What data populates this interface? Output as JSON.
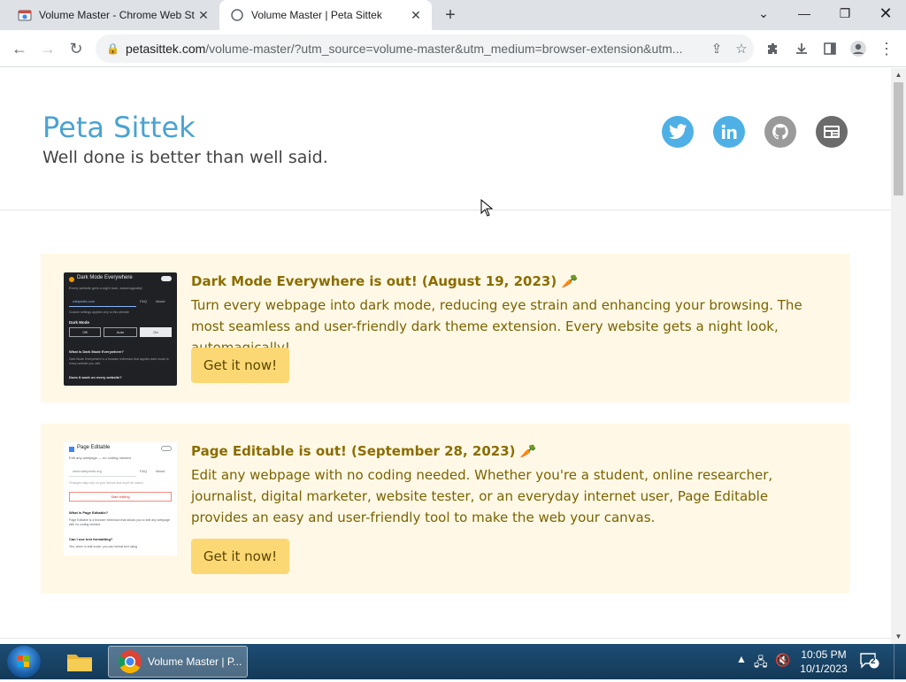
{
  "browser": {
    "tabs": [
      {
        "title": "Volume Master - Chrome Web Store",
        "active": false
      },
      {
        "title": "Volume Master | Peta Sittek",
        "active": true
      }
    ],
    "url_host": "petasittek.com",
    "url_path": "/volume-master/?utm_source=volume-master&utm_medium=browser-extension&utm..."
  },
  "site": {
    "title": "Peta Sittek",
    "tagline": "Well done is better than well said.",
    "social": [
      {
        "icon": "twitter-icon",
        "color": "#4fb0e6"
      },
      {
        "icon": "linkedin-icon",
        "color": "#4fb0e6"
      },
      {
        "icon": "github-icon",
        "color": "#9a9a9a"
      },
      {
        "icon": "email-icon",
        "color": "#6b6b6b"
      }
    ]
  },
  "cards": [
    {
      "headline": "Dark Mode Everywhere is out! (August 19, 2023)",
      "emoji": "🥕",
      "description": "Turn every webpage into dark mode, reducing eye strain and enhancing your browsing. The most seamless and user-friendly dark theme extension. Every website gets a night look, automagically!",
      "cta": "Get it now!",
      "preview": {
        "title": "Dark Mode Everywhere",
        "subtitle": "Every website gets a night look, automagically!",
        "domain": "wikipedia.com",
        "links": [
          "FAQ",
          "About"
        ],
        "setting_label": "Custom settings applied only to this website",
        "mode_label": "Dark Mode",
        "modes": [
          "Off",
          "Auto",
          "On"
        ],
        "q1": "What is Dark Mode Everywhere?",
        "a1": "Dark Mode Everywhere is a browser extension that applies dark mode to every website you visit.",
        "q2": "Does it work on every website?"
      }
    },
    {
      "headline": "Page Editable is out! (September 28, 2023)",
      "emoji": "🥕",
      "description": "Edit any webpage with no coding needed. Whether you're a student, online researcher, journalist, digital marketer, website tester, or an everyday internet user, Page Editable provides an easy and user-friendly tool to make the web your canvas.",
      "cta": "Get it now!",
      "preview": {
        "title": "Page Editable",
        "subtitle": "Edit any webpage — no coding needed",
        "domain": "www.wikipedia.org",
        "links": [
          "FAQ",
          "About"
        ],
        "setting_label": "Changes stay only on your device and won't be saved",
        "button": "Start editing",
        "q1": "What is Page Editable?",
        "a1": "Page Editable is a browser extension that allows you to edit any webpage with no coding needed.",
        "q2": "Can I use text formatting?",
        "a2": "Yes, when in edit mode, you can format text using"
      }
    }
  ],
  "taskbar": {
    "app_label": "Volume Master | P...",
    "time": "10:05 PM",
    "date": "10/1/2023",
    "notif_count": "2"
  }
}
